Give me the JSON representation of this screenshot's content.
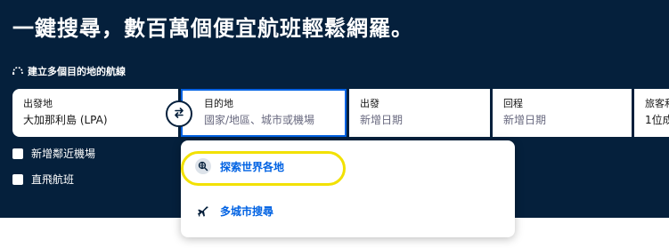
{
  "header": {
    "headline": "一鍵搜尋，數百萬個便宜航班輕鬆網羅。",
    "multi_destination_link": "建立多個目的地的航線"
  },
  "search_form": {
    "origin": {
      "label": "出發地",
      "value": "大加那利島 (LPA)"
    },
    "destination": {
      "label": "目的地",
      "placeholder": "國家/地區、城市或機場"
    },
    "depart": {
      "label": "出發",
      "placeholder": "新增日期"
    },
    "return": {
      "label": "回程",
      "placeholder": "新增日期"
    },
    "travelers": {
      "label": "旅客和",
      "value": "1位成"
    }
  },
  "options": {
    "nearby_airports": "新增鄰近機場",
    "direct_flights": "直飛航班"
  },
  "dropdown": {
    "items": [
      {
        "label": "探索世界各地",
        "icon": "globe-search-icon"
      },
      {
        "label": "多城市搜尋",
        "icon": "airplane-icon"
      }
    ]
  },
  "colors": {
    "hero_bg": "#05203c",
    "accent_blue": "#0062e3",
    "highlight_yellow": "#f2e100"
  }
}
